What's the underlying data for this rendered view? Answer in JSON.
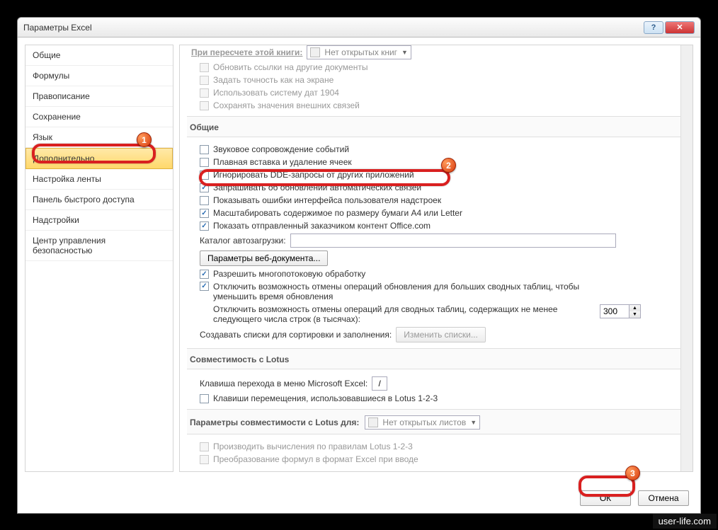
{
  "window": {
    "title": "Параметры Excel"
  },
  "sidebar": {
    "items": [
      {
        "label": "Общие"
      },
      {
        "label": "Формулы"
      },
      {
        "label": "Правописание"
      },
      {
        "label": "Сохранение"
      },
      {
        "label": "Язык"
      },
      {
        "label": "Дополнительно"
      },
      {
        "label": "Настройка ленты"
      },
      {
        "label": "Панель быстрого доступа"
      },
      {
        "label": "Надстройки"
      },
      {
        "label": "Центр управления безопасностью"
      }
    ],
    "selected_index": 5
  },
  "main": {
    "recalc_label": "При пересчете этой книги:",
    "recalc_dropdown": "Нет открытых книг",
    "opts1": [
      {
        "label": "Обновить ссылки на другие документы",
        "checked": false
      },
      {
        "label": "Задать точность как на экране",
        "checked": false
      },
      {
        "label": "Использовать систему дат 1904",
        "checked": false
      },
      {
        "label": "Сохранять значения внешних связей",
        "checked": false
      }
    ],
    "section_general": "Общие",
    "opts2": [
      {
        "label": "Звуковое сопровождение событий",
        "checked": false
      },
      {
        "label": "Плавная вставка и удаление ячеек",
        "checked": false
      },
      {
        "label": "Игнорировать DDE-запросы от других приложений",
        "checked": false
      },
      {
        "label": "Запрашивать об обновлении автоматических связей",
        "checked": true
      },
      {
        "label": "Показывать ошибки интерфейса пользователя надстроек",
        "checked": false
      },
      {
        "label": "Масштабировать содержимое по размеру бумаги A4 или Letter",
        "checked": true
      },
      {
        "label": "Показать отправленный заказчиком контент Office.com",
        "checked": true
      }
    ],
    "startup_label": "Каталог автозагрузки:",
    "startup_value": "",
    "webopts_btn": "Параметры веб-документа...",
    "opts3": [
      {
        "label": "Разрешить многопотоковую обработку",
        "checked": true
      },
      {
        "label": "Отключить возможность отмены операций обновления для больших сводных таблиц, чтобы уменьшить время обновления",
        "checked": true
      }
    ],
    "undo_rows_label": "Отключить возможность отмены операций для сводных таблиц, содержащих не менее следующего числа строк (в тысячах):",
    "undo_rows_value": "300",
    "lists_label": "Создавать списки для сортировки и заполнения:",
    "lists_btn": "Изменить списки...",
    "section_lotus": "Совместимость с Lotus",
    "lotus_key_label": "Клавиша перехода в меню Microsoft Excel:",
    "lotus_key_value": "/",
    "lotus_keys_cb": "Клавиши перемещения, использовавшиеся в Lotus 1-2-3",
    "section_lotus_params": "Параметры совместимости с Lotus для:",
    "lotus_dd": "Нет открытых листов",
    "lotus_opts": [
      {
        "label": "Производить вычисления по правилам Lotus 1-2-3"
      },
      {
        "label": "Преобразование формул в формат Excel при вводе"
      }
    ]
  },
  "footer": {
    "ok": "ОК",
    "cancel": "Отмена"
  },
  "badges": {
    "b1": "1",
    "b2": "2",
    "b3": "3"
  },
  "watermark": "user-life.com"
}
